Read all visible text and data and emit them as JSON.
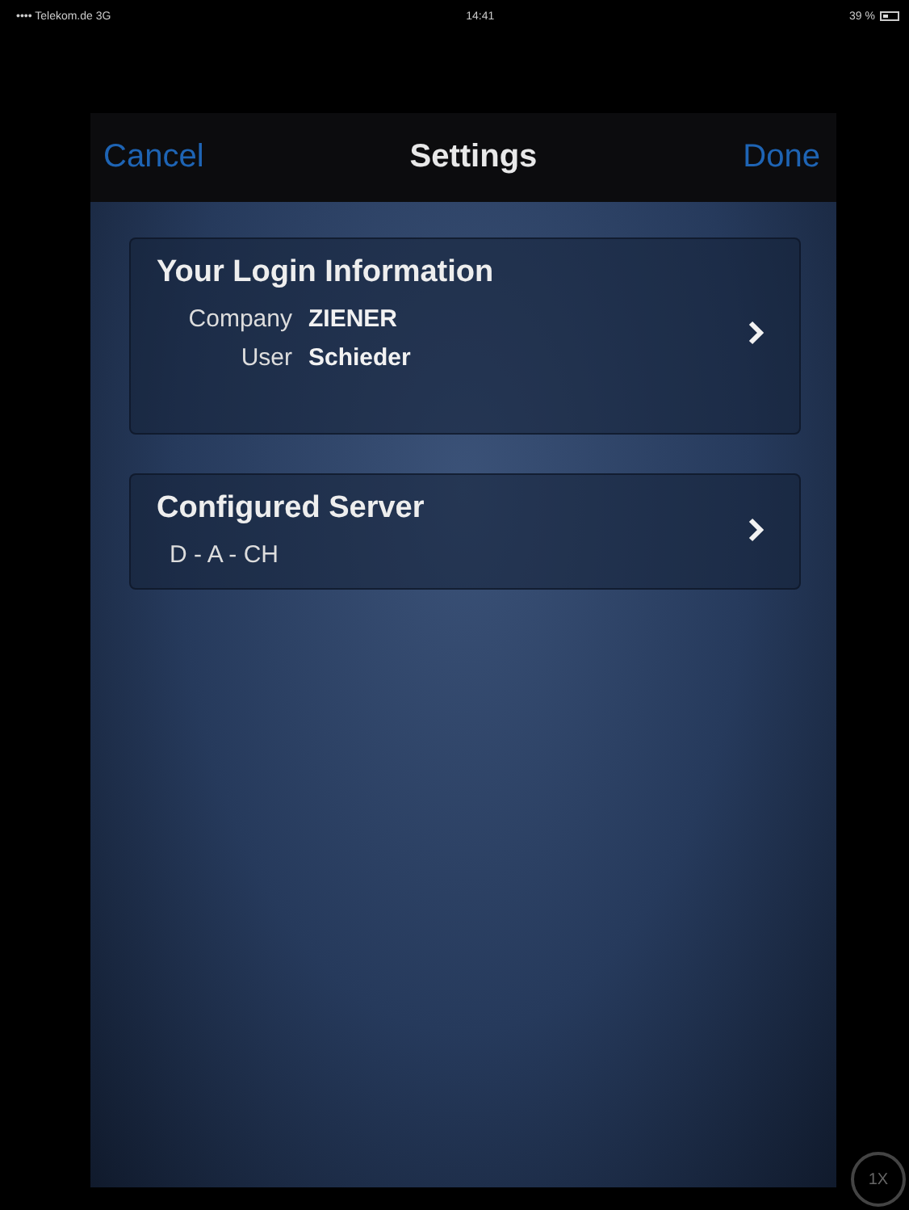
{
  "status_bar": {
    "carrier": "•••• Telekom.de 3G",
    "time": "14:41",
    "battery": "39 %"
  },
  "nav_bar": {
    "left_button": "Cancel",
    "title": "Settings",
    "right_button": "Done"
  },
  "sections": [
    {
      "title": "Your Login Information",
      "rows": [
        {
          "label": "Company",
          "value": "ZIENER"
        },
        {
          "label": "User",
          "value": "Schieder"
        }
      ]
    },
    {
      "title": "Configured Server",
      "rows": [
        {
          "value": "D - A - CH"
        }
      ]
    }
  ],
  "zoom_button": "1X"
}
